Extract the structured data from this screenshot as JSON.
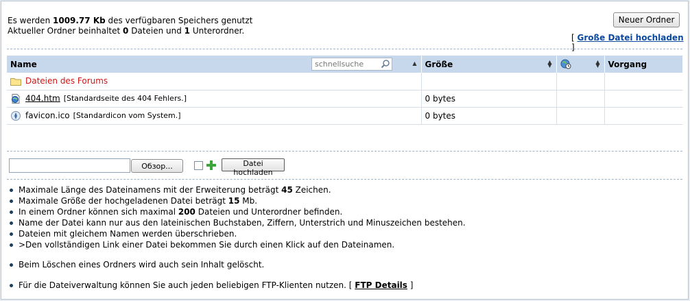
{
  "info": {
    "line1_pre": "Es werden ",
    "line1_value": "1009.77 Kb",
    "line1_post": " des verfügbaren Speichers genutzt",
    "line2_pre": "Aktueller Ordner beinhaltet ",
    "line2_files": "0",
    "line2_mid": " Dateien und ",
    "line2_folders": "1",
    "line2_post": " Unterordner."
  },
  "toolbar": {
    "new_folder": "Neuer Ordner",
    "big_upload_open": "[ ",
    "big_upload_label": "Große Datei hochladen",
    "big_upload_close": " ]"
  },
  "table": {
    "col_name": "Name",
    "search_placeholder": "schnellsuche",
    "col_size": "Größe",
    "col_action": "Vorgang",
    "rows": [
      {
        "name": "Dateien des Forums",
        "desc": "",
        "size": "",
        "type": "folder"
      },
      {
        "name": "404.htm",
        "desc": "[Standardseite des 404 Fehlers.]",
        "size": "0 bytes",
        "type": "html"
      },
      {
        "name": "favicon.ico",
        "desc": "[Standardicon vom System.]",
        "size": "0 bytes",
        "type": "ico"
      }
    ]
  },
  "upload": {
    "browse": "Обзор...",
    "submit": "Datei hochladen"
  },
  "notes": {
    "n1_pre": "Maximale Länge des Dateinamens mit der Erweiterung beträgt ",
    "n1_val": "45",
    "n1_post": " Zeichen.",
    "n2_pre": "Maximale Größe der hochgeladenen Datei beträgt ",
    "n2_val": "15",
    "n2_post": " Mb.",
    "n3_pre": "In einem Ordner können sich maximal ",
    "n3_val": "200",
    "n3_post": " Dateien und Unterordner befinden.",
    "n4": "Name der Datei kann nur aus den lateinischen Buchstaben, Ziffern, Unterstrich und Minuszeichen bestehen.",
    "n5": "Dateien mit gleichem Namen werden überschrieben.",
    "n6": ">Den vollständigen Link einer Datei bekommen Sie durch einen Klick auf den Dateinamen.",
    "n7": "Beim Löschen eines Ordners wird auch sein Inhalt gelöscht.",
    "n8_pre": "Für die Dateiverwaltung können Sie auch jeden beliebigen FTP-Klienten nutzen. [ ",
    "n8_link": "FTP Details",
    "n8_post": " ]"
  }
}
